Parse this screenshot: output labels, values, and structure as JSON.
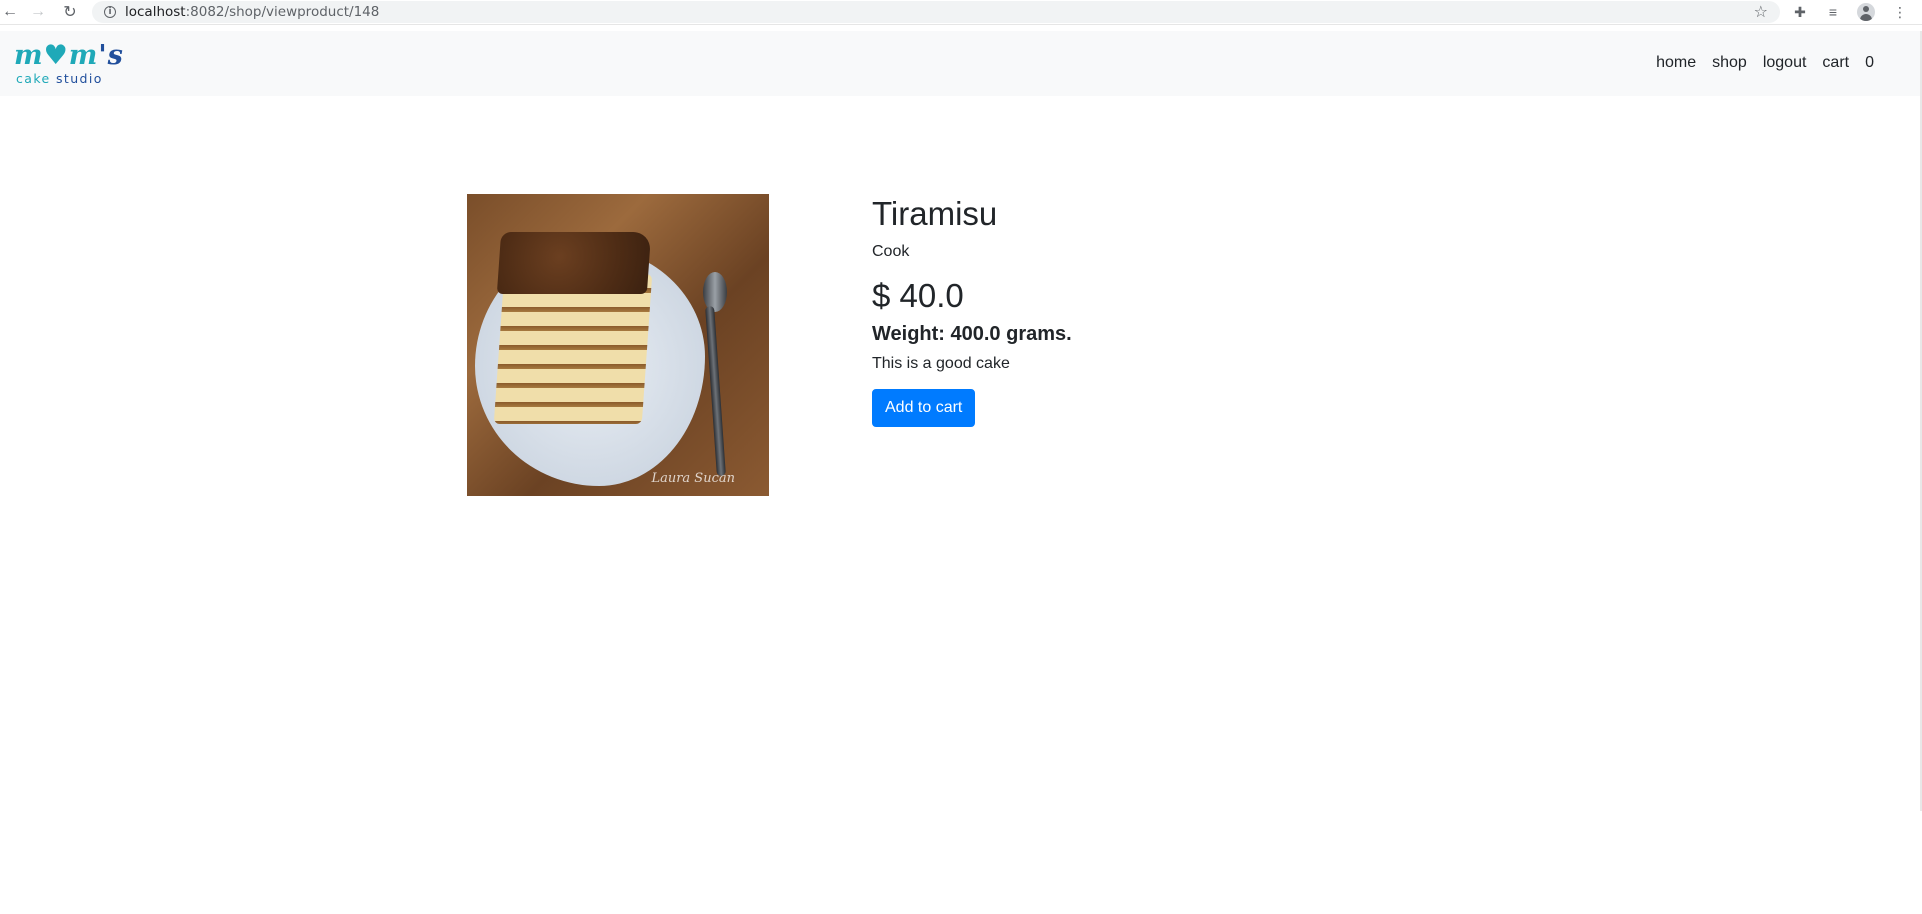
{
  "browser": {
    "url_host": "localhost",
    "url_path": ":8082/shop/viewproduct/148",
    "icons": [
      "back-icon",
      "forward-icon",
      "reload-icon",
      "info-icon",
      "star-icon",
      "extensions-icon",
      "media-control-icon",
      "profile-icon",
      "menu-icon"
    ]
  },
  "navbar": {
    "logo_top_main": "m♥m",
    "logo_top_s": "'s",
    "logo_bottom_cake": "cake ",
    "logo_bottom_studio": "studio",
    "links": [
      "home",
      "shop",
      "logout",
      "cart",
      "0"
    ]
  },
  "product": {
    "name": "Tiramisu",
    "category": "Cook",
    "price": "$ 40.0",
    "weight": "Weight: 400.0 grams.",
    "description": "This is a good cake",
    "add_to_cart_label": "Add to cart",
    "image_watermark": "Laura Sucan"
  },
  "colors": {
    "primary_button": "#007bff",
    "navbar_bg": "#f8f9fa",
    "logo_teal": "#1fa9b8",
    "logo_navy": "#214f9c"
  }
}
